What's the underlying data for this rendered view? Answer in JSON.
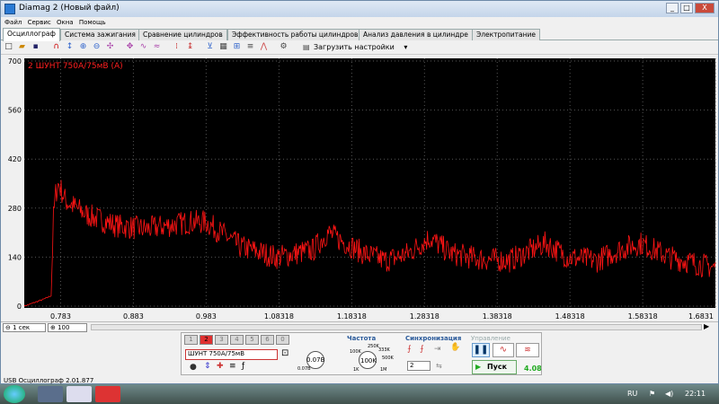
{
  "window": {
    "title": "Diamag 2 (Новый файл)",
    "min": "_",
    "max": "□",
    "close": "X"
  },
  "menu": [
    "Файл",
    "Сервис",
    "Окна",
    "Помощь"
  ],
  "tabs": [
    "Осциллограф",
    "Система зажигания",
    "Сравнение цилиндров",
    "Эффективность работы цилиндров",
    "Анализ давления в цилиндре",
    "Электропитание"
  ],
  "toolbar": {
    "load_label": "Загрузить настройки"
  },
  "chart_data": {
    "type": "line",
    "channel_label": "2 ШУНТ 750А/75мВ (А)",
    "y_ticks": [
      "700",
      "560",
      "420",
      "280",
      "140",
      "0"
    ],
    "x_ticks": [
      "0.783",
      "0.883",
      "0.983",
      "1.08318",
      "1.18318",
      "1.28318",
      "1.38318",
      "1.48318",
      "1.58318",
      "1.6831"
    ],
    "xlim": [
      0.733,
      1.6831
    ],
    "ylim": [
      0,
      700
    ],
    "series": [
      {
        "color": "#ff1414",
        "x": [
          0.733,
          0.76,
          0.77,
          0.773,
          0.776,
          0.78,
          0.79,
          0.82,
          0.86,
          0.9,
          0.96,
          0.983,
          1.03,
          1.08,
          1.13,
          1.15,
          1.2,
          1.23,
          1.26,
          1.29,
          1.32,
          1.36,
          1.4,
          1.45,
          1.48,
          1.52,
          1.55,
          1.58,
          1.62,
          1.66,
          1.683
        ],
        "y": [
          0,
          20,
          30,
          250,
          320,
          350,
          300,
          260,
          230,
          220,
          240,
          240,
          170,
          140,
          160,
          210,
          150,
          130,
          150,
          195,
          150,
          135,
          130,
          180,
          140,
          130,
          160,
          180,
          140,
          120,
          110
        ]
      }
    ],
    "grid": true
  },
  "controls": {
    "timebase": "1 сек",
    "scale": "100",
    "channels": [
      "1",
      "2",
      "3",
      "4",
      "5",
      "6",
      "0"
    ],
    "channel_name": "ШУНТ 750А/75мВ",
    "volt_value": "0.07В",
    "volt_min": "0.07В",
    "volt_max": "",
    "freq_title": "Частота",
    "freq_value": "100K",
    "freq_labels": [
      "250K",
      "333K",
      "100K",
      "500K",
      "1K",
      "1M"
    ],
    "sync_title": "Синхронизация",
    "sync_value": "2",
    "control_title": "Управление",
    "start_label": "Пуск",
    "counter": "4.08"
  },
  "statusbar": {
    "text": "USB Осциллограф 2.01.877"
  },
  "taskbar": {
    "lang": "RU",
    "time": "22:11"
  }
}
